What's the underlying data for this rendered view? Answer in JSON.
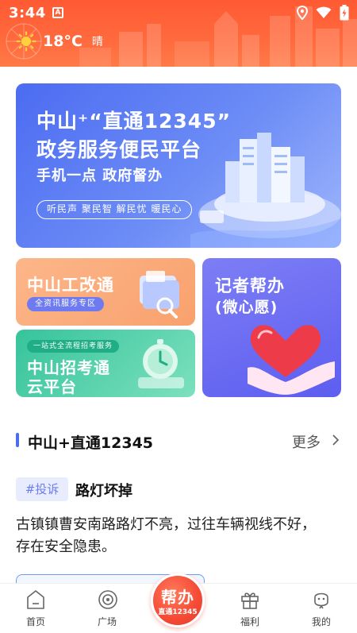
{
  "status_bar": {
    "time": "3:44",
    "notification_letter": "A"
  },
  "weather": {
    "temperature": "18°C",
    "condition": "晴"
  },
  "banner": {
    "title_line1": "中山⁺“直通12345”",
    "title_line2": "政务服务便民平台",
    "subtitle": "手机一点  政府督办",
    "tags": "听民声  聚民智  解民忧  暖民心"
  },
  "cards": {
    "gongai": {
      "title": "中山工改通",
      "tag": "全资讯服务专区"
    },
    "zhaokao": {
      "tag": "一站式全流程招考服务",
      "title_line1": "中山招考通",
      "title_line2": "云平台"
    },
    "jizhe": {
      "title_line1": "记者帮办",
      "title_line2": "(微心愿)"
    }
  },
  "section": {
    "title": "中山+直通12345",
    "more_label": "更多"
  },
  "post": {
    "tag": "#投诉",
    "title": "路灯坏掉",
    "body": "古镇镇曹安南路路灯不亮，过往车辆视线不好，存在安全隐患。"
  },
  "bottom_nav": {
    "home": "首页",
    "square": "广场",
    "center_main": "帮办",
    "center_sub": "直通12345",
    "welfare": "福利",
    "mine": "我的"
  },
  "colors": {
    "header_orange": "#ff5a33",
    "accent_blue": "#4c6cf2",
    "center_red": "#f54a35"
  }
}
